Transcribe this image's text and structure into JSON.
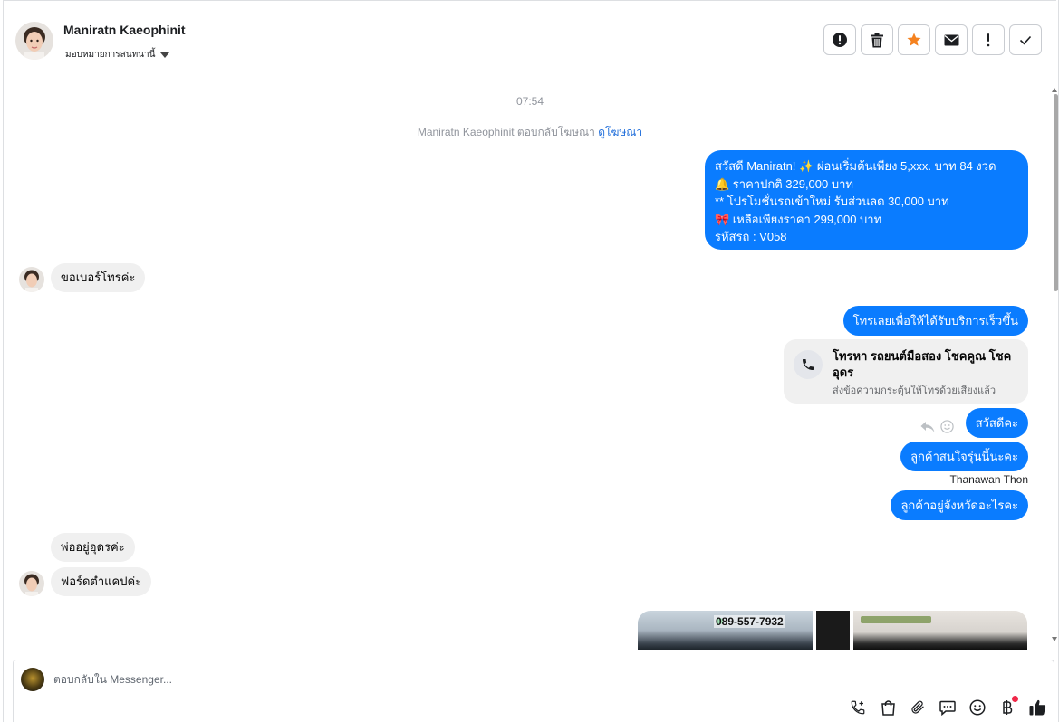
{
  "header": {
    "contact_name": "Maniratn Kaeophinit",
    "assign_label": "มอบหมายการสนทนานี้",
    "actions": [
      "alert-circle-icon",
      "trash-icon",
      "star-icon",
      "envelope-icon",
      "exclamation-icon",
      "check-icon"
    ]
  },
  "thread": {
    "timestamp": "07:54",
    "ad_notice": "Maniratn Kaeophinit ตอบกลับโฆษณา",
    "ad_link": "ดูโฆษณา",
    "msg_promo": {
      "line1": "สวัสดี Maniratn! ✨  ผ่อนเริ่มต้นเพียง 5,xxx. บาท 84 งวด",
      "line2": "🔔 ราคาปกติ 329,000 บาท",
      "line3": "** โปรโมชั่นรถเข้าใหม่ รับส่วนลด 30,000 บาท",
      "line4": "🎀  เหลือเพียงราคา 299,000 บาท",
      "line5": " รหัสรถ : V058"
    },
    "msg_in_1": "ขอเบอร์โทรค่ะ",
    "msg_out_1": "โทรเลยเพื่อให้ได้รับบริการเร็วขึ้น",
    "call_card": {
      "title": "โทรหา รถยนต์มือสอง โชคคูณ โชค อุดร",
      "subtitle": "ส่งข้อความกระตุ้นให้โทรด้วยเสียงแล้ว"
    },
    "msg_out_2": "สวัสดีคะ",
    "msg_out_3": "ลูกค้าสนใจรุ่นนี้นะคะ",
    "sender_name": "Thanawan Thon",
    "msg_out_4": "ลูกค้าอยู่จังหวัดอะไรคะ",
    "msg_in_2": "พ่ออยู่อุดรค่ะ",
    "msg_in_3": "ฟอร์ดตำแคปค่ะ",
    "image_plate_text": "089-557-7932"
  },
  "composer": {
    "placeholder": "ตอบกลับใน Messenger...",
    "tools": [
      "phone-plus-icon",
      "shopping-bag-icon",
      "paperclip-icon",
      "saved-reply-icon",
      "emoji-icon",
      "baht-payment-icon",
      "thumbs-up-icon"
    ]
  },
  "colors": {
    "outgoing_bubble": "#0a7cff",
    "incoming_bubble": "#f0f0f0",
    "star_accent": "#f5821f",
    "link": "#216fdb"
  }
}
